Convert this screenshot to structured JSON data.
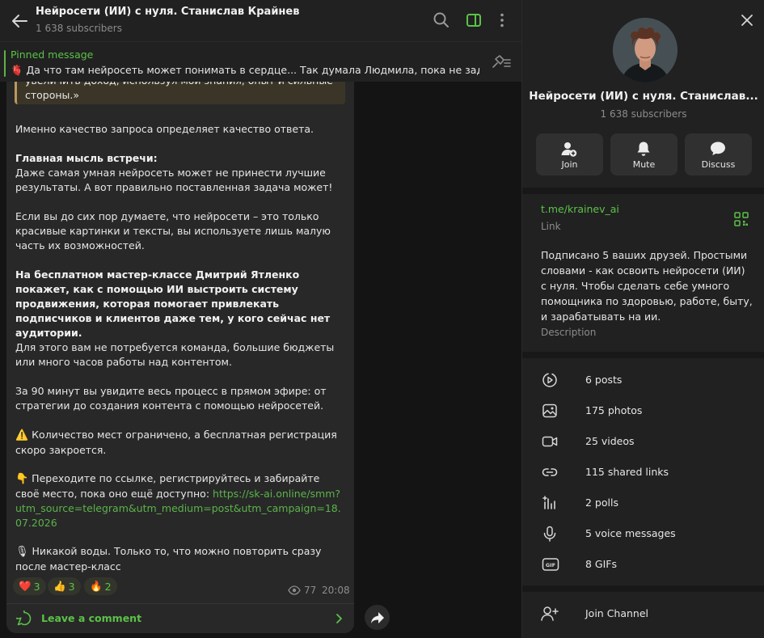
{
  "header": {
    "title": "Нейросети (ИИ) с нуля. Станислав Крайнев",
    "subscribers": "1 638 subscribers"
  },
  "pinned": {
    "title": "Pinned message",
    "text": "🫀 Да что там нейросеть может понимать в сердце...  Так думала Людмила, пока не задала..."
  },
  "message": {
    "quote": "увеличить доход, используя мои знания, опыт и сильные стороны.»",
    "p1": "Именно качество запроса определяет качество ответа.",
    "p2_bold": "Главная мысль встречи:",
    "p2": "Даже самая умная нейросеть может не принести лучшие результаты. А вот правильно поставленная задача может!",
    "p3": "Если вы до сих пор думаете, что нейросети –  это только красивые картинки и тексты, вы используете лишь малую часть их возможностей.",
    "p4_bold": "На бесплатном мастер-классе Дмитрий Ятленко покажет, как с помощью ИИ выстроить систему продвижения, которая помогает привлекать подписчиков и клиентов даже тем, у кого сейчас нет аудитории.",
    "p5": "Для этого вам не потребуется команда,  большие бюджеты или много часов работы над контентом.",
    "p6": "За 90 минут вы увидите весь процесс в прямом эфире: от стратегии до создания контента с помощью нейросетей.",
    "p7_emoji": "⚠️",
    "p7": "Количество мест ограничено, а бесплатная регистрация скоро закроется.",
    "p8_emoji": "👇",
    "p8": "Переходите по ссылке, регистрируйтесь и забирайте своё место, пока оно ещё доступно: ",
    "p8_link": "https://sk-ai.online/smm?utm_source=telegram&utm_medium=post&utm_campaign=18.07.2026",
    "p9_emoji": "🎙",
    "p9": "Никакой воды. Только то, что можно повторить сразу после мастер-класс"
  },
  "reactions": [
    {
      "emoji": "❤️",
      "count": "3"
    },
    {
      "emoji": "👍",
      "count": "3"
    },
    {
      "emoji": "🔥",
      "count": "2"
    }
  ],
  "meta": {
    "views": "77",
    "time": "20:08"
  },
  "comment": {
    "label": "Leave a comment"
  },
  "panel": {
    "title": "Нейросети (ИИ) с нуля. Станислав...",
    "subscribers": "1 638 subscribers",
    "actions": [
      {
        "label": "Join",
        "icon": "add-user-icon"
      },
      {
        "label": "Mute",
        "icon": "bell-icon"
      },
      {
        "label": "Discuss",
        "icon": "chat-bubble-icon"
      }
    ],
    "link": "t.me/krainev_ai",
    "link_label": "Link",
    "description": "Подписано 5 ваших друзей. Простыми словами - как освоить нейросети (ИИ) с нуля. Чтобы сделать себе умного помощника по здоровью, работе, быту, и зарабатывать на ии.",
    "description_label": "Description",
    "media": [
      {
        "label": "6 posts",
        "icon": "posts-icon"
      },
      {
        "label": "175 photos",
        "icon": "photo-icon"
      },
      {
        "label": "25 videos",
        "icon": "video-icon"
      },
      {
        "label": "115 shared links",
        "icon": "link-icon"
      },
      {
        "label": "2 polls",
        "icon": "poll-icon"
      },
      {
        "label": "5 voice messages",
        "icon": "microphone-icon"
      },
      {
        "label": "8 GIFs",
        "icon": "gif-icon"
      }
    ],
    "join_channel": "Join Channel"
  },
  "colors": {
    "accent": "#5bc248",
    "panel_bg": "#212121",
    "chat_bg": "#141414",
    "bubble_bg": "#282828"
  }
}
